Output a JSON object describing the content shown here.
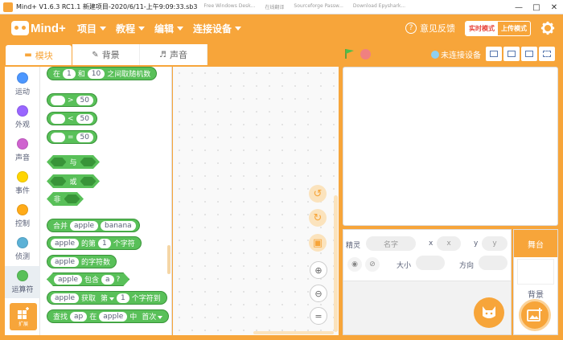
{
  "window": {
    "title": "Mind+ V1.6.3 RC1.1  新建项目-2020/6/11-上午9:09:33.sb3",
    "background_tabs": [
      "Free Windows Desk...",
      "在线翻译",
      "Sourceforge Passw...",
      "Download Epyshark..."
    ]
  },
  "menubar": {
    "logo": "Mind+",
    "menus": [
      {
        "label": "项目"
      },
      {
        "label": "教程"
      },
      {
        "label": "编辑"
      },
      {
        "label": "连接设备"
      }
    ],
    "feedback_label": "意见反馈",
    "mode_realtime": "实时模式",
    "mode_upload": "上传模式"
  },
  "tabs": [
    {
      "label": "模块",
      "icon": "blocks-icon"
    },
    {
      "label": "背景",
      "icon": "brush-icon"
    },
    {
      "label": "声音",
      "icon": "speaker-icon"
    }
  ],
  "connection_status": "未连接设备",
  "categories": [
    {
      "label": "运动",
      "color": "#4c97ff"
    },
    {
      "label": "外观",
      "color": "#9966ff"
    },
    {
      "label": "声音",
      "color": "#cf63cf"
    },
    {
      "label": "事件",
      "color": "#ffd500"
    },
    {
      "label": "控制",
      "color": "#ffab19"
    },
    {
      "label": "侦测",
      "color": "#5cb1d6"
    },
    {
      "label": "运算符",
      "color": "#59c059"
    }
  ],
  "extension_label": "扩展",
  "blocks": {
    "random": {
      "pre": "在",
      "a": "1",
      "mid": "和",
      "b": "10",
      "post": "之间取随机数"
    },
    "gt": {
      "op": ">",
      "val": "50"
    },
    "lt": {
      "op": "<",
      "val": "50"
    },
    "eq": {
      "op": "=",
      "val": "50"
    },
    "and": "与",
    "or": "或",
    "not": "非",
    "join": {
      "label": "合并",
      "a": "apple",
      "b": "banana"
    },
    "letter": {
      "a": "apple",
      "mid": "的第",
      "n": "1",
      "post": "个字符"
    },
    "length": {
      "a": "apple",
      "post": "的字符数"
    },
    "contains": {
      "a": "apple",
      "mid": "包含",
      "b": "a",
      "post": "?"
    },
    "getchar": {
      "a": "apple",
      "mid": "获取",
      "dd": "第",
      "n": "1",
      "post": "个字符到"
    },
    "find": {
      "label": "查找",
      "a": "ap",
      "mid": "在",
      "b": "apple",
      "mid2": "中",
      "dd": "首次"
    }
  },
  "sprite_info": {
    "sprite_label": "精灵",
    "name_placeholder": "名字",
    "x_label": "x",
    "x_placeholder": "x",
    "y_label": "y",
    "y_placeholder": "y",
    "size_label": "大小",
    "direction_label": "方向"
  },
  "stage_panel": {
    "title": "舞台",
    "backdrop_label": "背景"
  }
}
